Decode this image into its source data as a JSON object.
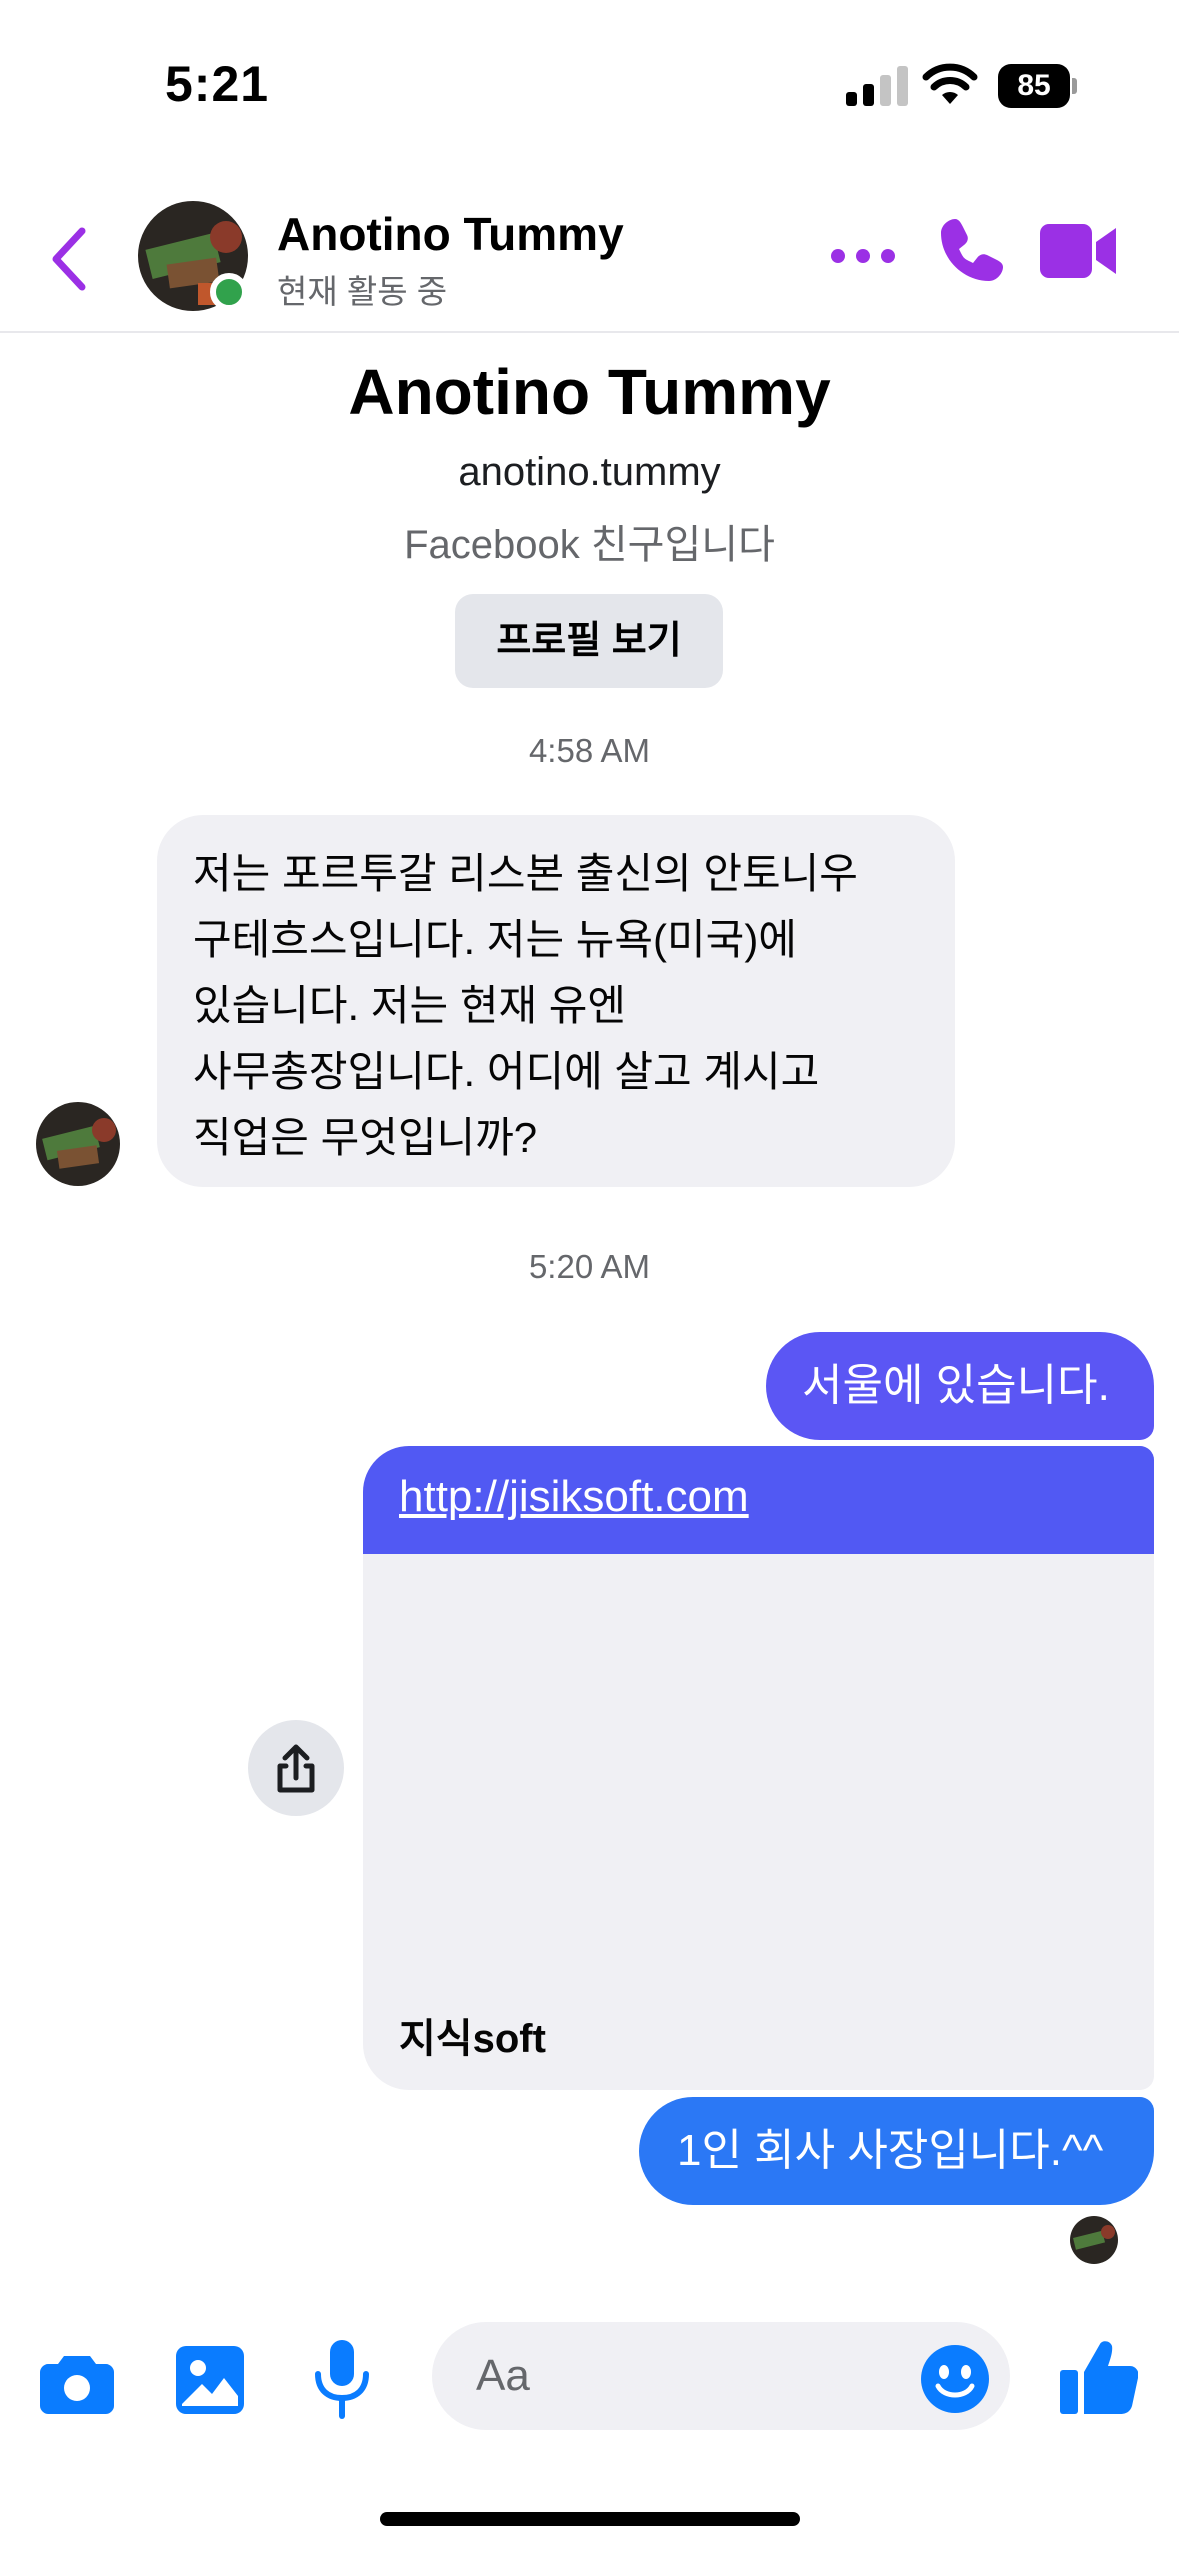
{
  "status_bar": {
    "time": "5:21",
    "battery": "85"
  },
  "header": {
    "name": "Anotino Tummy",
    "status": "현재 활동 중",
    "back_icon": "chevron-left-icon",
    "more_icon": "more-dots-icon",
    "call_icon": "phone-icon",
    "video_icon": "video-camera-icon",
    "accent_color": "#9b30e5"
  },
  "profile": {
    "name": "Anotino Tummy",
    "handle": "anotino.tummy",
    "relation": "Facebook 친구입니다",
    "view_profile_label": "프로필 보기"
  },
  "messages": {
    "timestamp_1": "4:58 AM",
    "incoming_1": [
      "저는 포르투갈 리스본 출신의 안토니우",
      "구테흐스입니다. 저는 뉴욕(미국)에",
      "있습니다. 저는 현재 유엔",
      "사무총장입니다. 어디에 살고 계시고",
      "직업은 무엇입니까?"
    ],
    "timestamp_2": "5:20 AM",
    "outgoing_1": "서울에 있습니다.",
    "link_preview": {
      "url": "http://jisiksoft.com",
      "title": "지식soft"
    },
    "outgoing_2": "1인 회사 사장입니다.^^"
  },
  "composer": {
    "placeholder": "Aa",
    "camera_icon": "camera-icon",
    "gallery_icon": "image-icon",
    "mic_icon": "microphone-icon",
    "emoji_icon": "smiley-icon",
    "like_icon": "thumbs-up-icon",
    "accent_color": "#0a7cff"
  }
}
